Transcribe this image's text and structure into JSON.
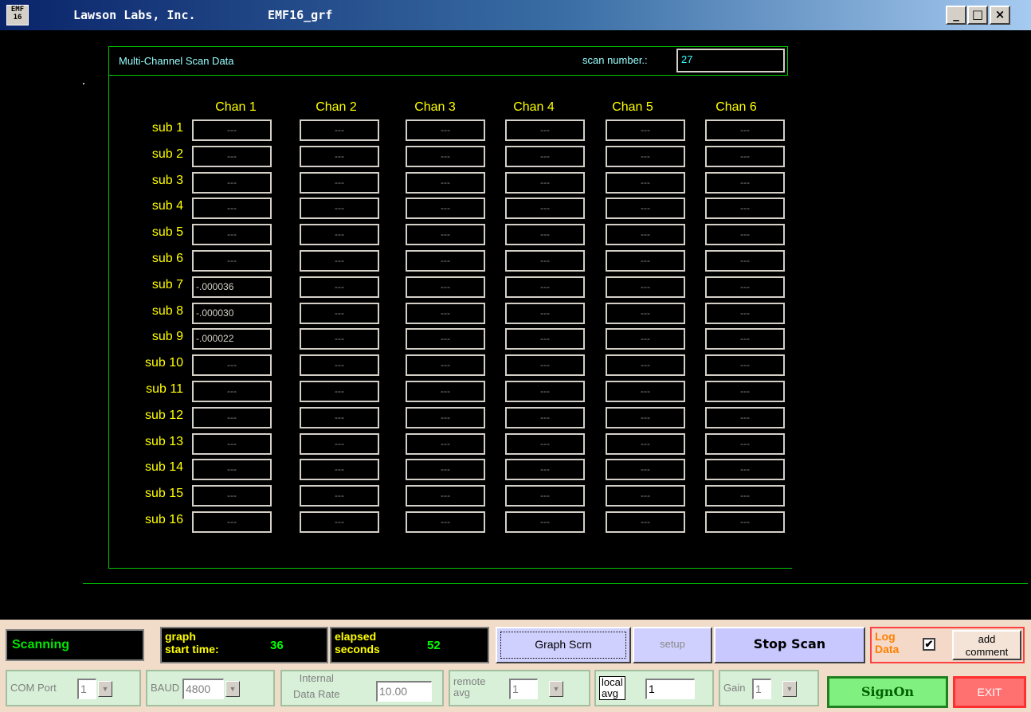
{
  "window": {
    "icon_text": "EMF 16",
    "company": "Lawson Labs, Inc.",
    "app_name": "EMF16_grf",
    "controls": {
      "minimize": "_",
      "maximize": "□",
      "close": "×"
    }
  },
  "panel": {
    "title": "Multi-Channel Scan Data",
    "scan_number_label": "scan number.:",
    "scan_number": "27"
  },
  "grid": {
    "channels": [
      "Chan 1",
      "Chan 2",
      "Chan 3",
      "Chan 4",
      "Chan 5",
      "Chan 6"
    ],
    "subs": [
      "sub 1",
      "sub 2",
      "sub 3",
      "sub 4",
      "sub 5",
      "sub 6",
      "sub 7",
      "sub 8",
      "sub 9",
      "sub 10",
      "sub 11",
      "sub 12",
      "sub 13",
      "sub 14",
      "sub 15",
      "sub 16"
    ],
    "empty_value": "---",
    "values": [
      [
        "---",
        "---",
        "---",
        "---",
        "---",
        "---"
      ],
      [
        "---",
        "---",
        "---",
        "---",
        "---",
        "---"
      ],
      [
        "---",
        "---",
        "---",
        "---",
        "---",
        "---"
      ],
      [
        "---",
        "---",
        "---",
        "---",
        "---",
        "---"
      ],
      [
        "---",
        "---",
        "---",
        "---",
        "---",
        "---"
      ],
      [
        "---",
        "---",
        "---",
        "---",
        "---",
        "---"
      ],
      [
        "-.000036",
        "---",
        "---",
        "---",
        "---",
        "---"
      ],
      [
        "-.000030",
        "---",
        "---",
        "---",
        "---",
        "---"
      ],
      [
        "-.000022",
        "---",
        "---",
        "---",
        "---",
        "---"
      ],
      [
        "---",
        "---",
        "---",
        "---",
        "---",
        "---"
      ],
      [
        "---",
        "---",
        "---",
        "---",
        "---",
        "---"
      ],
      [
        "---",
        "---",
        "---",
        "---",
        "---",
        "---"
      ],
      [
        "---",
        "---",
        "---",
        "---",
        "---",
        "---"
      ],
      [
        "---",
        "---",
        "---",
        "---",
        "---",
        "---"
      ],
      [
        "---",
        "---",
        "---",
        "---",
        "---",
        "---"
      ],
      [
        "---",
        "---",
        "---",
        "---",
        "---",
        "---"
      ]
    ]
  },
  "status": {
    "text": "Scanning"
  },
  "graph_start": {
    "label_line1": "graph",
    "label_line2": "start time:",
    "value": "36"
  },
  "elapsed": {
    "label_line1": "elapsed",
    "label_line2": "seconds",
    "value": "52"
  },
  "buttons": {
    "graph_scrn": "Graph Scrn",
    "setup": "setup",
    "stop_scan": "Stop Scan",
    "add_comment_line1": "add",
    "add_comment_line2": "comment",
    "signon": "SignOn",
    "exit": "EXIT"
  },
  "log": {
    "label_line1": "Log",
    "label_line2": "Data",
    "checked_mark": "✔"
  },
  "settings": {
    "com_port": {
      "label": "COM Port",
      "value": "1"
    },
    "baud": {
      "label": "BAUD",
      "value": "4800"
    },
    "data_rate": {
      "label_line1": "Internal",
      "label_line2": "Data Rate",
      "value": "10.00"
    },
    "remote_avg": {
      "label_line1": "remote",
      "label_line2": "avg",
      "value": "1"
    },
    "local_avg": {
      "label_line1": "local",
      "label_line2": "avg",
      "value": "1"
    },
    "gain": {
      "label": "Gain",
      "value": "1"
    }
  },
  "colors": {
    "accent_green": "#00c800",
    "label_yellow": "#ffff00",
    "title_cyan": "#99ffff"
  }
}
